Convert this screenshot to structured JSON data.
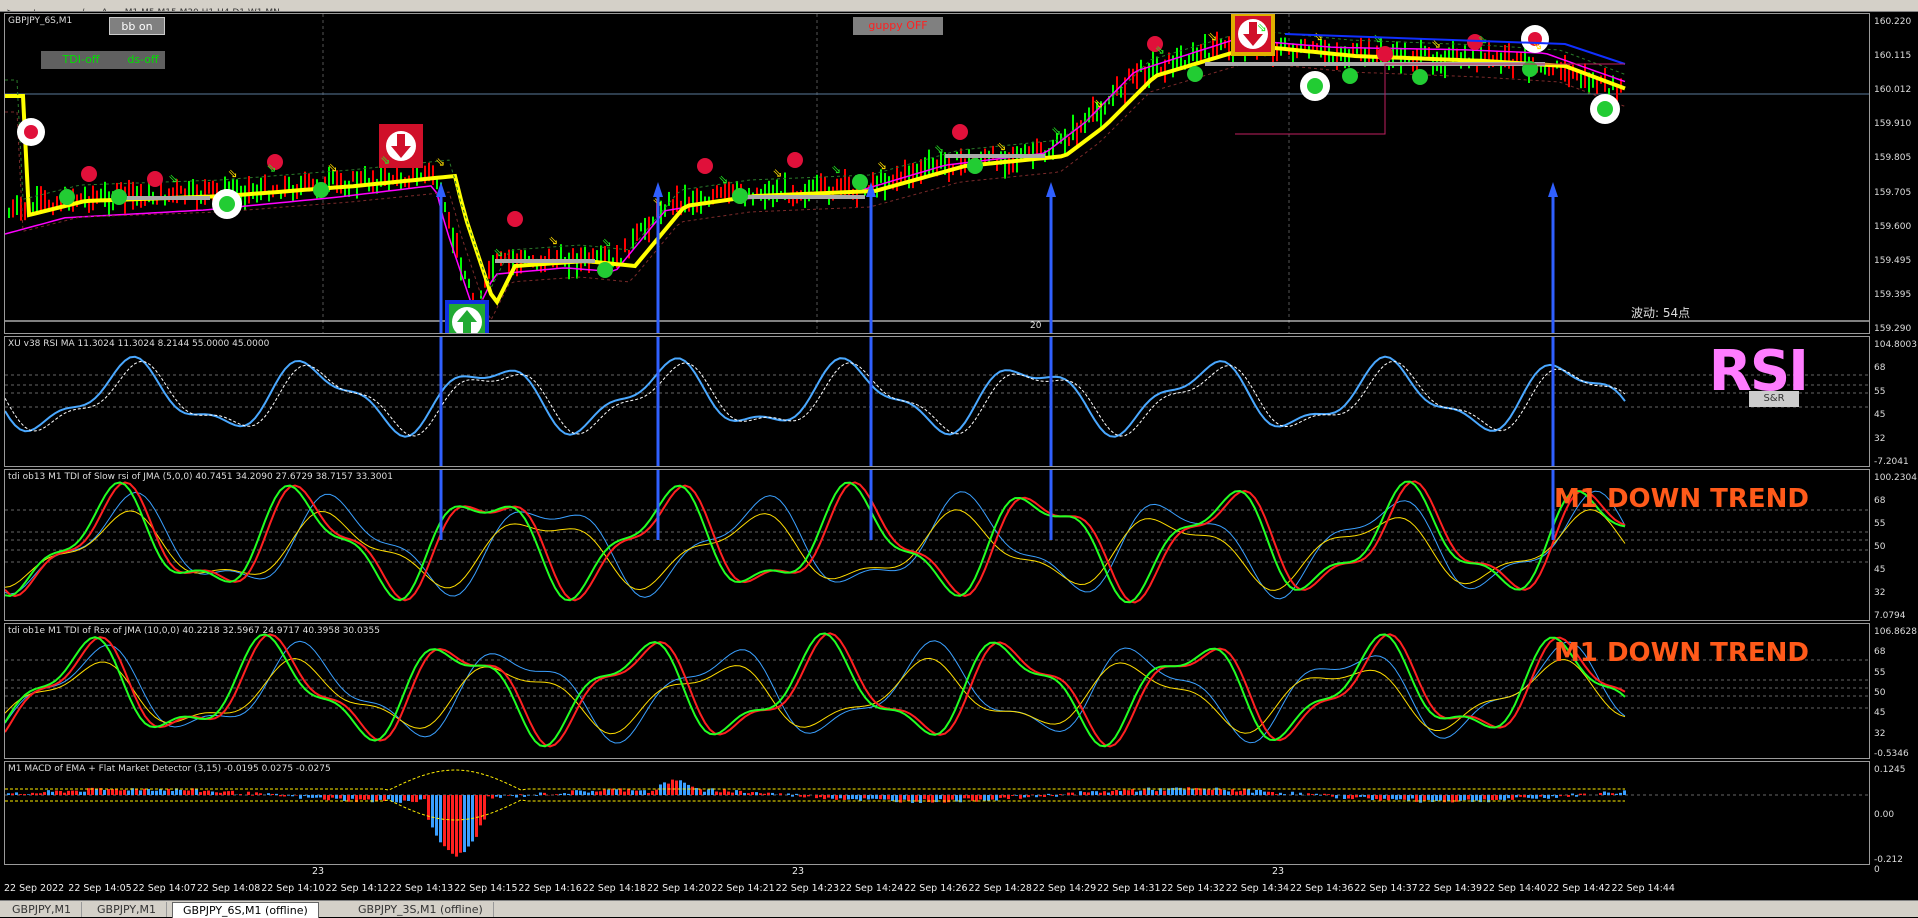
{
  "window": {
    "symbol_title": "GBPJPY_6S,M1"
  },
  "buttons": {
    "bb": "bb on",
    "tdi": "TDI-off",
    "ds": "ds-off",
    "guppy": "guppy OFF"
  },
  "main_chart": {
    "price_axis": [
      "160.220",
      "160.115",
      "160.012",
      "159.910",
      "159.805",
      "159.705",
      "159.600",
      "159.495",
      "159.395",
      "159.290"
    ],
    "current_price": "160.012",
    "watermark": "波动: 54点",
    "day_marker": "20"
  },
  "rsi_pane": {
    "title": "XU v38 RSI MA 11.3024 11.3024 8.2144 55.0000 45.0000",
    "axis": [
      "104.8003",
      "68",
      "55",
      "45",
      "32",
      "-7.2041"
    ],
    "big_label": "RSI",
    "sr_label": "S&R"
  },
  "tdi1_pane": {
    "title": "tdi ob13 M1 TDI of Slow rsi of JMA (5,0,0) 40.7451 34.2090 27.6729 38.7157 33.3001",
    "axis": [
      "100.2304",
      "68",
      "55",
      "50",
      "45",
      "32",
      "7.0794"
    ],
    "trend": "M1 DOWN TREND"
  },
  "tdi2_pane": {
    "title": "tdi ob1e M1 TDI of Rsx of JMA (10,0,0) 40.2218 32.5967 24.9717 40.3958 30.0355",
    "axis": [
      "106.8628",
      "68",
      "55",
      "50",
      "45",
      "32",
      "-0.5346"
    ],
    "trend": "M1 DOWN TREND"
  },
  "macd_pane": {
    "title": "M1 MACD of EMA + Flat Market Detector (3,15) -0.0195 0.0275 -0.0275",
    "axis": [
      "0.1245",
      "0.00",
      "-0.212"
    ],
    "zero_label": "0"
  },
  "date_axis": [
    "22 Sep 2022",
    "22 Sep 14:05",
    "22 Sep 14:07",
    "22 Sep 14:08",
    "22 Sep 14:10",
    "22 Sep 14:12",
    "22 Sep 14:13",
    "22 Sep 14:15",
    "22 Sep 14:16",
    "22 Sep 14:18",
    "22 Sep 14:20",
    "22 Sep 14:21",
    "22 Sep 14:23",
    "22 Sep 14:24",
    "22 Sep 14:26",
    "22 Sep 14:28",
    "22 Sep 14:29",
    "22 Sep 14:31",
    "22 Sep 14:32",
    "22 Sep 14:34",
    "22 Sep 14:36",
    "22 Sep 14:37",
    "22 Sep 14:39",
    "22 Sep 14:40",
    "22 Sep 14:42",
    "22 Sep 14:44"
  ],
  "period_markers": [
    "23",
    "23",
    "23"
  ],
  "tabs": [
    "GBPJPY,M1",
    "GBPJPY,M1",
    "GBPJPY_6S,M1 (offline)",
    "GBPJPY_3S,M1 (offline)"
  ],
  "colors": {
    "bull": "#00ff00",
    "bear": "#ff0000",
    "magenta": "#ff00ff",
    "yellow": "#ffff00",
    "trend": "#ff5a1a",
    "arrow_blue": "#3060ff"
  }
}
